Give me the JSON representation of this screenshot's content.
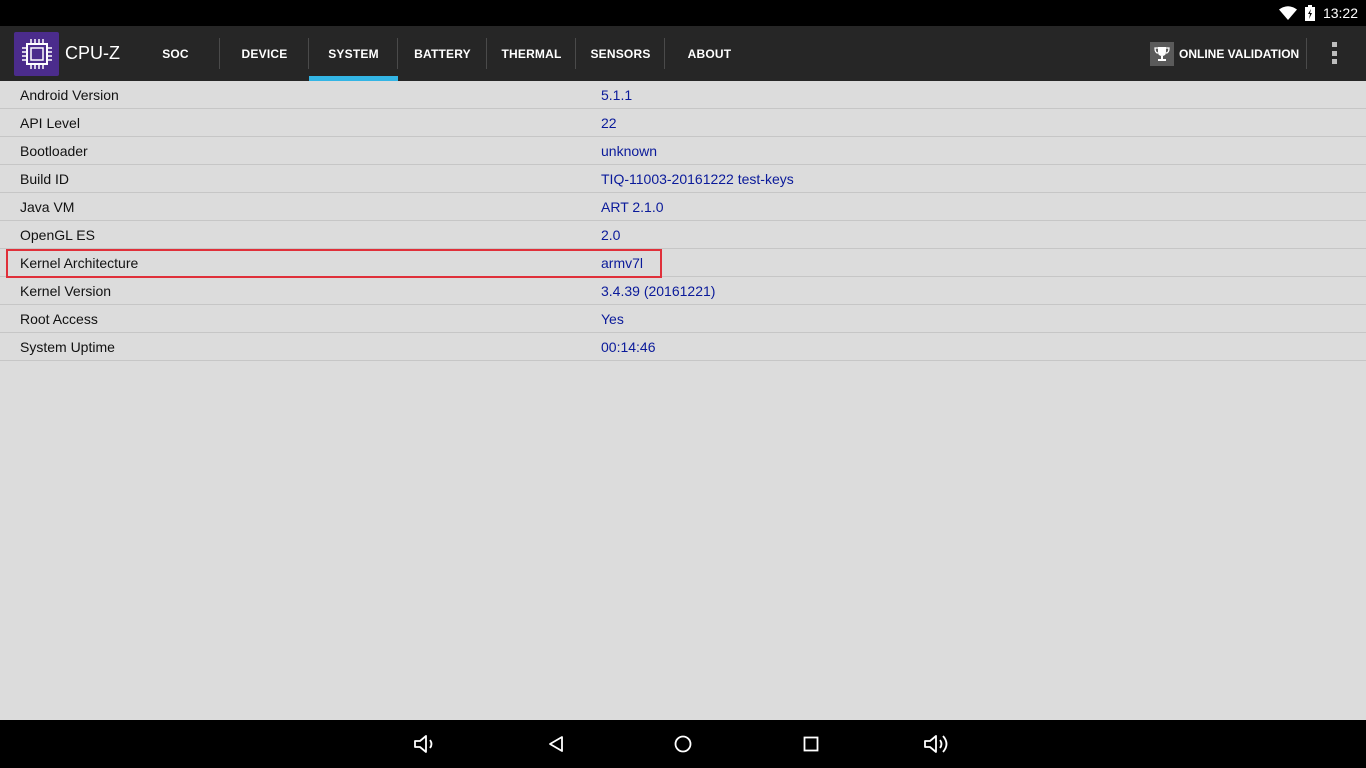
{
  "status": {
    "time": "13:22",
    "icons": [
      "wifi-icon",
      "battery-charging-icon"
    ]
  },
  "app": {
    "title": "CPU-Z",
    "accent_color": "#33b5e5",
    "logo_color": "#4b2c8c"
  },
  "tabs": [
    {
      "label": "SOC",
      "active": false
    },
    {
      "label": "DEVICE",
      "active": false
    },
    {
      "label": "SYSTEM",
      "active": true
    },
    {
      "label": "BATTERY",
      "active": false
    },
    {
      "label": "THERMAL",
      "active": false
    },
    {
      "label": "SENSORS",
      "active": false
    },
    {
      "label": "ABOUT",
      "active": false
    }
  ],
  "actions": {
    "online_validation_label": "ONLINE VALIDATION",
    "online_validation_icon": "trophy-icon",
    "overflow_icon": "more-vert-icon"
  },
  "system_info": [
    {
      "label": "Android Version",
      "value": "5.1.1"
    },
    {
      "label": "API Level",
      "value": "22"
    },
    {
      "label": "Bootloader",
      "value": "unknown"
    },
    {
      "label": "Build ID",
      "value": "TIQ-11003-20161222 test-keys"
    },
    {
      "label": "Java VM",
      "value": "ART 2.1.0"
    },
    {
      "label": "OpenGL ES",
      "value": "2.0"
    },
    {
      "label": "Kernel Architecture",
      "value": "armv7l",
      "highlighted": true
    },
    {
      "label": "Kernel Version",
      "value": "3.4.39 (20161221)"
    },
    {
      "label": "Root Access",
      "value": "Yes"
    },
    {
      "label": "System Uptime",
      "value": "00:14:46"
    }
  ],
  "navbar": {
    "icons": [
      "volume-down-icon",
      "back-icon",
      "home-icon",
      "recents-icon",
      "volume-up-icon"
    ]
  },
  "highlight_color": "#e0303a"
}
